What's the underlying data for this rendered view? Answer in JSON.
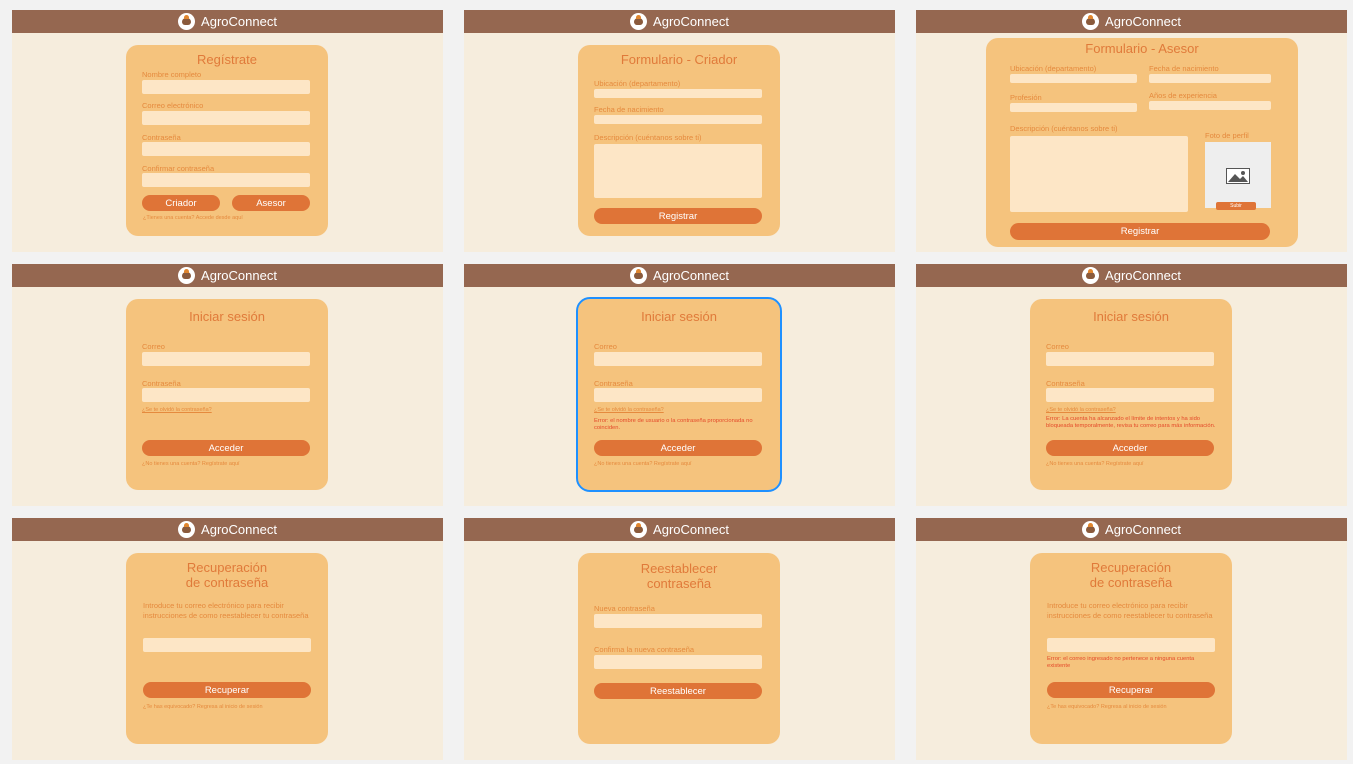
{
  "brand": "AgroConnect",
  "colors": {
    "topbar": "#956750",
    "background": "#f6eddd",
    "card": "#f5c37d",
    "input": "#fde6c6",
    "accent": "#df7437",
    "error": "#e44a2a",
    "selection": "#1e90ff"
  },
  "icons": {
    "logo": "farmer-logo-icon",
    "photo": "image-placeholder-icon"
  },
  "screens": [
    {
      "title": "Regístrate",
      "labels": [
        "Nombre completo",
        "Correo electrónico",
        "Contraseña",
        "Confirmar contraseña"
      ],
      "buttons": [
        "Criador",
        "Asesor"
      ],
      "footer": "¿Tienes una cuenta? Accede desde aquí"
    },
    {
      "title": "Formulario - Criador",
      "labels": [
        "Ubicación (departamento)",
        "Fecha de nacimiento",
        "Descripción (cuéntanos sobre ti)"
      ],
      "button": "Registrar"
    },
    {
      "title": "Formulario - Asesor",
      "labels": [
        "Ubicación (departamento)",
        "Fecha de nacimiento",
        "Profesión",
        "Años de experiencia",
        "Descripción (cuéntanos sobre ti)",
        "Foto de perfil"
      ],
      "upload": "Subir",
      "button": "Registrar"
    },
    {
      "title": "Iniciar sesión",
      "labels": [
        "Correo",
        "Contraseña"
      ],
      "forgot": "¿Se te olvidó la contraseña?",
      "button": "Acceder",
      "footer": "¿No tienes una cuenta? Regístrate aquí"
    },
    {
      "title": "Iniciar sesión",
      "labels": [
        "Correo",
        "Contraseña"
      ],
      "forgot": "¿Se te olvidó la contraseña?",
      "error": "Error: el nombre de usuario o la contraseña proporcionada no coinciden.",
      "button": "Acceder",
      "footer": "¿No tienes una cuenta? Regístrate aquí"
    },
    {
      "title": "Iniciar sesión",
      "labels": [
        "Correo",
        "Contraseña"
      ],
      "forgot": "¿Se te olvidó la contraseña?",
      "error": "Error: La cuenta ha alcanzado el límite de intentos y ha sido bloqueada temporalmente, revisa tu correo para más información.",
      "button": "Acceder",
      "footer": "¿No tienes una cuenta? Regístrate aquí"
    },
    {
      "title_line1": "Recuperación",
      "title_line2": "de contraseña",
      "instructions": "Introduce tu correo electrónico para recibir instrucciones de como reestablecer tu contraseña",
      "button": "Recuperar",
      "footer": "¿Te has equivocado? Regresa al inicio de sesión"
    },
    {
      "title_line1": "Reestablecer",
      "title_line2": "contraseña",
      "labels": [
        "Nueva contraseña",
        "Confirma la nueva contraseña"
      ],
      "button": "Reestablecer"
    },
    {
      "title_line1": "Recuperación",
      "title_line2": "de contraseña",
      "instructions": "Introduce tu correo electrónico para recibir instrucciones de como reestablecer tu contraseña",
      "error": "Error: el correo ingresado no pertenece a ninguna cuenta existente",
      "button": "Recuperar",
      "footer": "¿Te has equivocado? Regresa al inicio de sesión"
    }
  ]
}
